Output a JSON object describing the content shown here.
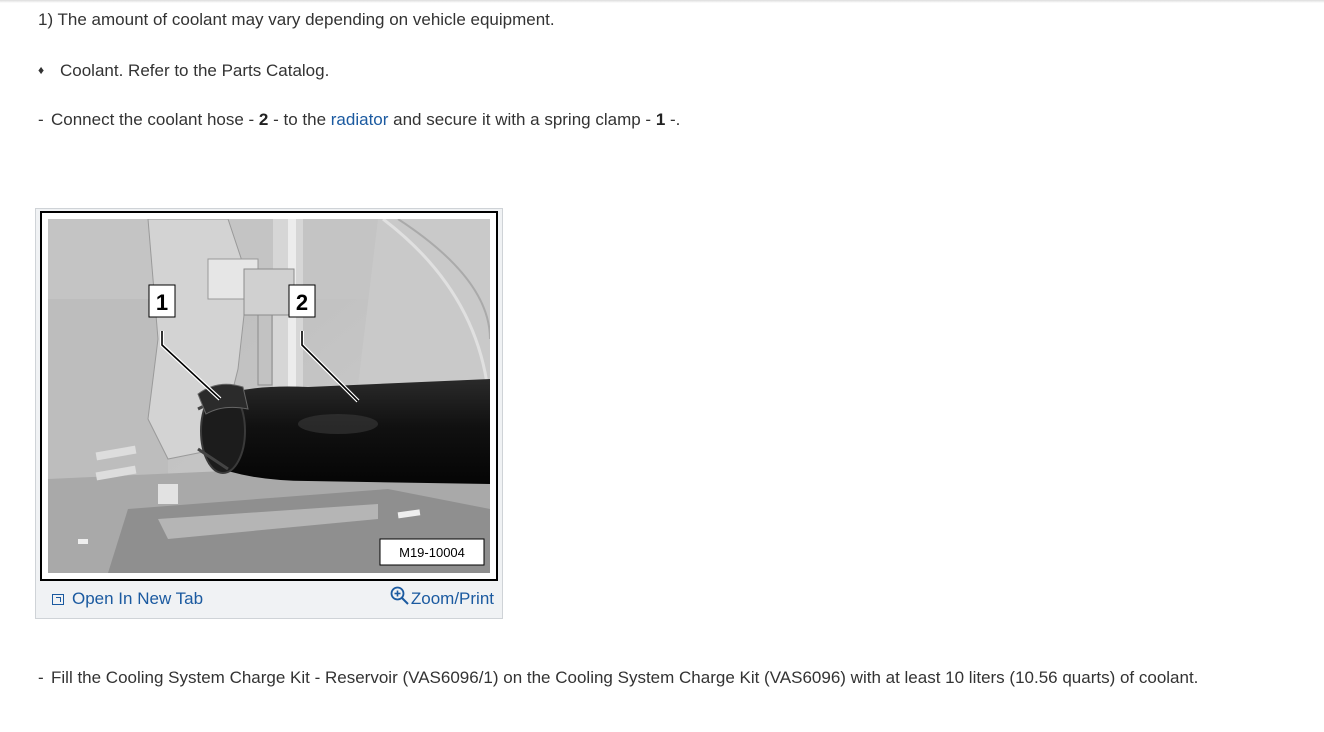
{
  "note": "1) The amount of coolant may vary depending on vehicle equipment.",
  "bullet": {
    "symbol": "♦",
    "text": "Coolant. Refer to the Parts Catalog."
  },
  "step_connect": {
    "dash": "-",
    "part1": "Connect the coolant hose - ",
    "num_hose": "2",
    "part2": " - to the ",
    "link": "radiator",
    "part3": " and secure it with a spring clamp - ",
    "num_clamp": "1",
    "part4": " -."
  },
  "figure": {
    "callout_1": "1",
    "callout_2": "2",
    "image_code": "M19-10004",
    "open_tab_label": "Open In New Tab",
    "zoom_label": "Zoom/Print"
  },
  "step_fill": {
    "dash": "-",
    "text": "Fill the Cooling System Charge Kit - Reservoir (VAS6096/1) on the Cooling System Charge Kit (VAS6096) with at least 10 liters (10.56 quarts) of coolant."
  },
  "colors": {
    "link": "#1b5aa0",
    "text": "#333333",
    "figure_bg": "#f0f2f4"
  }
}
